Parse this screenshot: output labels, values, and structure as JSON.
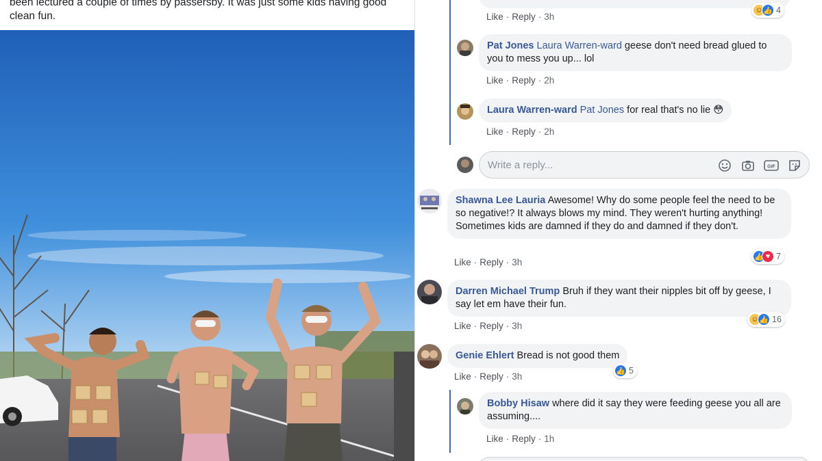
{
  "post": {
    "text": "been lectured a couple of times by passersby. It was just some kids having good clean fun."
  },
  "thread1": {
    "top_actions": {
      "like": "Like",
      "reply": "Reply",
      "time": "3h",
      "react_count": "4"
    },
    "reply1": {
      "name": "Pat Jones",
      "mention": "Laura Warren-ward",
      "text": " geese don't need bread glued to you to mess you up... lol",
      "like": "Like",
      "reply": "Reply",
      "time": "2h"
    },
    "reply2": {
      "name": "Laura Warren-ward",
      "mention": "Pat Jones",
      "text": " for real that's no lie 😳",
      "like": "Like",
      "reply": "Reply",
      "time": "2h"
    },
    "reply_box": {
      "placeholder": "Write a reply..."
    }
  },
  "comments": [
    {
      "name": "Shawna Lee Lauria",
      "text": " Awesome! Why do some people feel the need to be so negative!? It always blows my mind. They weren't hurting anything! Sometimes kids are damned if they do and damned if they don't.",
      "like": "Like",
      "reply": "Reply",
      "time": "3h",
      "react_count": "7"
    },
    {
      "name": "Darren Michael Trump",
      "text": " Bruh if they want their nipples bit off by geese, I say let em have their fun.",
      "like": "Like",
      "reply": "Reply",
      "time": "3h",
      "react_count": "16"
    },
    {
      "name": "Genie Ehlert",
      "text": " Bread is not good them",
      "like": "Like",
      "reply": "Reply",
      "time": "3h",
      "react_count": "5"
    }
  ],
  "thread2": {
    "reply1": {
      "name": "Bobby Hisaw",
      "text": " where did it say they were feeding geese you all are assuming....",
      "like": "Like",
      "reply": "Reply",
      "time": "1h"
    }
  },
  "icons": {
    "emoji": "smiley-icon",
    "camera": "camera-icon",
    "gif": "gif-icon",
    "sticker": "sticker-icon"
  },
  "colors": {
    "name": "#385898",
    "bubble": "#f2f3f5",
    "thread_line": "#4267b2",
    "meta": "#606770"
  }
}
